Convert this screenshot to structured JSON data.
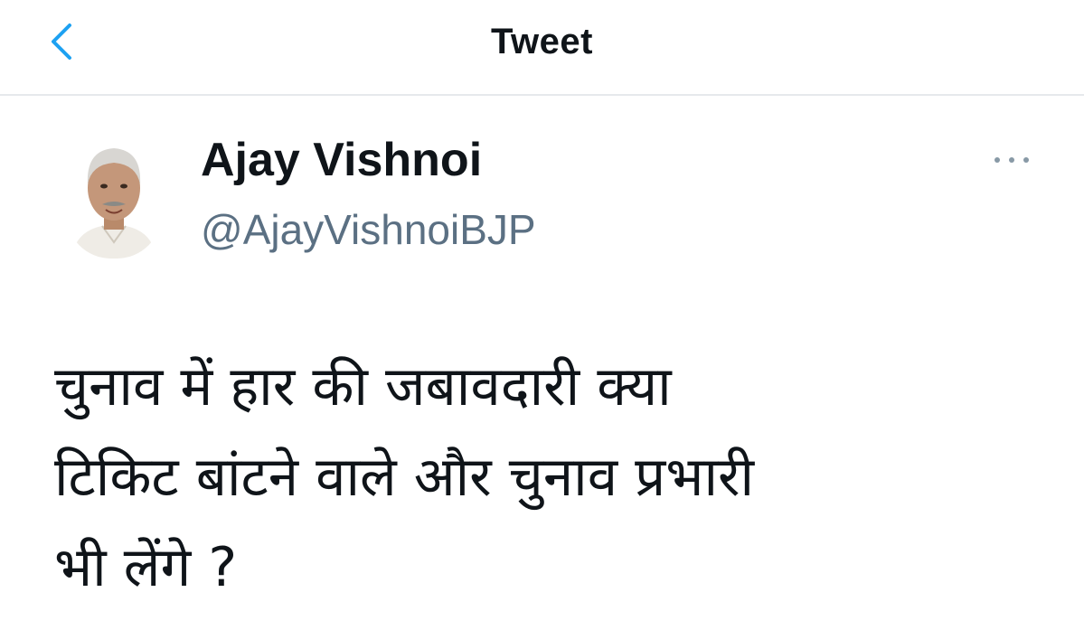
{
  "header": {
    "title": "Tweet",
    "back_icon": "chevron-left-icon"
  },
  "tweet": {
    "author": {
      "display_name": "Ajay Vishnoi",
      "handle": "@AjayVishnoiBJP",
      "avatar": "profile-photo"
    },
    "more_icon": "more-options-icon",
    "text": "चुनाव में हार की जबावदारी क्या\nटिकिट बांटने वाले और चुनाव प्रभारी\nभी लेंगे ?"
  },
  "colors": {
    "accent": "#1da1f2",
    "text_primary": "#0f1419",
    "text_secondary": "#5b7083",
    "divider": "#e6e9ec"
  }
}
